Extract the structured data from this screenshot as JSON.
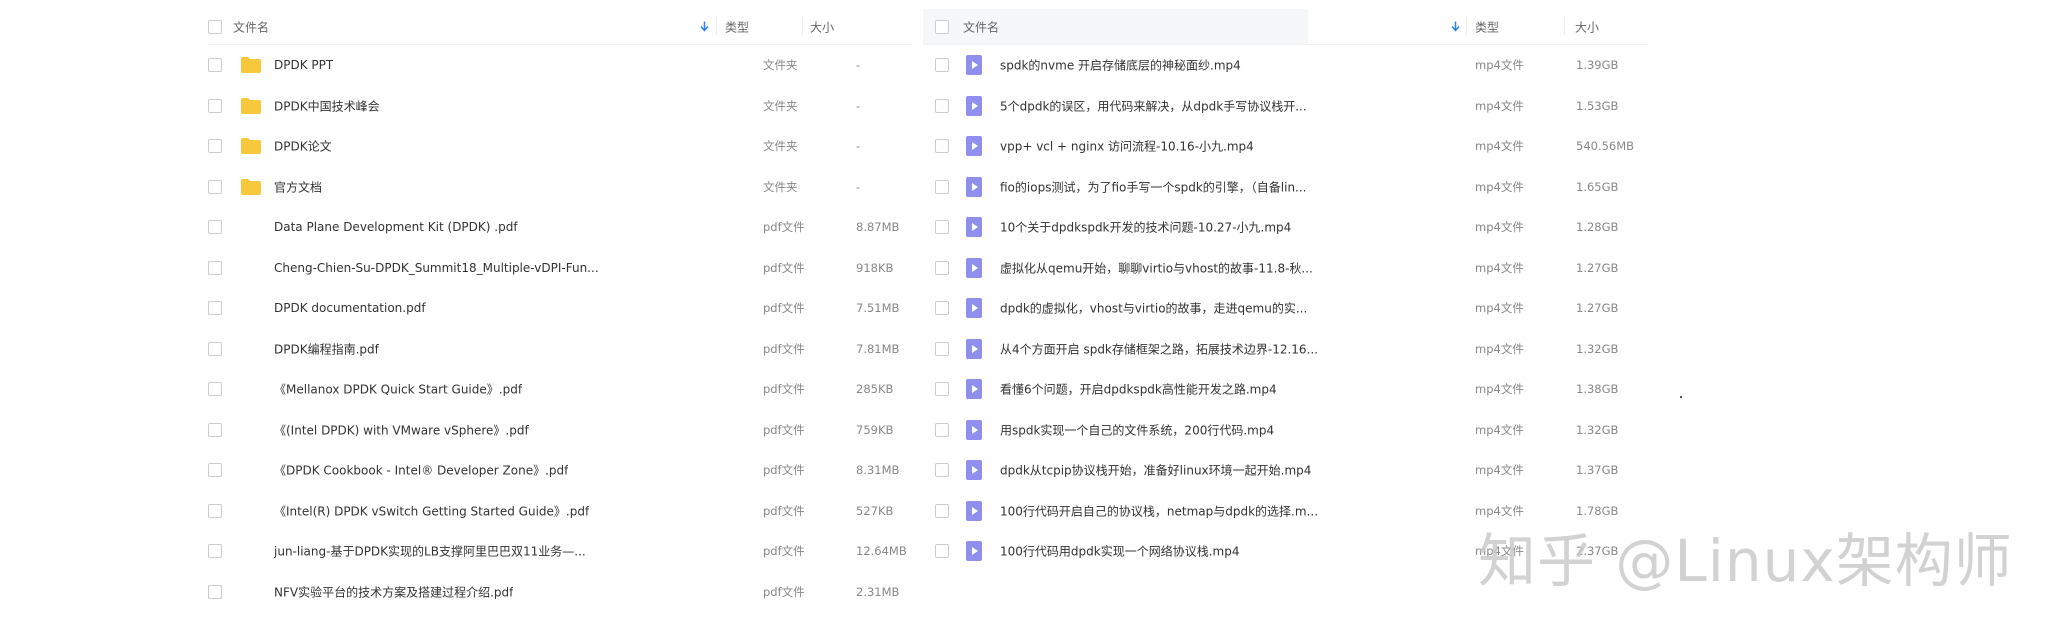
{
  "left": {
    "headers": {
      "name": "文件名",
      "type": "类型",
      "size": "大小"
    },
    "files": [
      {
        "icon": "folder-icon",
        "name": "DPDK  PPT",
        "type": "文件夹",
        "size": "-"
      },
      {
        "icon": "folder-icon",
        "name": "DPDK中国技术峰会",
        "type": "文件夹",
        "size": "-"
      },
      {
        "icon": "folder-icon",
        "name": "DPDK论文",
        "type": "文件夹",
        "size": "-"
      },
      {
        "icon": "folder-icon",
        "name": "官方文档",
        "type": "文件夹",
        "size": "-"
      },
      {
        "icon": "pdf-icon",
        "name": "Data Plane Development Kit (DPDK) .pdf",
        "type": "pdf文件",
        "size": "8.87MB"
      },
      {
        "icon": "pdf-icon",
        "name": "Cheng-Chien-Su-DPDK_Summit18_Multiple-vDPI-Fun...",
        "type": "pdf文件",
        "size": "918KB"
      },
      {
        "icon": "pdf-icon",
        "name": "DPDK documentation.pdf",
        "type": "pdf文件",
        "size": "7.51MB"
      },
      {
        "icon": "pdf-icon",
        "name": "DPDK编程指南.pdf",
        "type": "pdf文件",
        "size": "7.81MB"
      },
      {
        "icon": "pdf-icon",
        "name": "《Mellanox DPDK Quick Start Guide》.pdf",
        "type": "pdf文件",
        "size": "285KB"
      },
      {
        "icon": "pdf-icon",
        "name": "《(Intel DPDK) with VMware vSphere》.pdf",
        "type": "pdf文件",
        "size": "759KB"
      },
      {
        "icon": "pdf-icon",
        "name": "《DPDK Cookbook - Intel® Developer Zone》.pdf",
        "type": "pdf文件",
        "size": "8.31MB"
      },
      {
        "icon": "pdf-icon",
        "name": "《Intel(R) DPDK vSwitch Getting Started Guide》.pdf",
        "type": "pdf文件",
        "size": "527KB"
      },
      {
        "icon": "pdf-icon",
        "name": "jun-liang-基于DPDK实现的LB支撑阿里巴巴双11业务—...",
        "type": "pdf文件",
        "size": "12.64MB"
      },
      {
        "icon": "pdf-icon",
        "name": "NFV实验平台的技术方案及搭建过程介绍.pdf",
        "type": "pdf文件",
        "size": "2.31MB"
      }
    ]
  },
  "right": {
    "headers": {
      "name": "文件名",
      "type": "类型",
      "size": "大小"
    },
    "files": [
      {
        "icon": "video-icon",
        "name": "spdk的nvme 开启存储底层的神秘面纱.mp4",
        "type": "mp4文件",
        "size": "1.39GB"
      },
      {
        "icon": "video-icon",
        "name": "5个dpdk的误区，用代码来解决，从dpdk手写协议栈开...",
        "type": "mp4文件",
        "size": "1.53GB"
      },
      {
        "icon": "video-icon",
        "name": "vpp+ vcl + nginx 访问流程-10.16-小九.mp4",
        "type": "mp4文件",
        "size": "540.56MB"
      },
      {
        "icon": "video-icon",
        "name": "fio的iops测试，为了fio手写一个spdk的引擎，（自备lin...",
        "type": "mp4文件",
        "size": "1.65GB"
      },
      {
        "icon": "video-icon",
        "name": "10个关于dpdkspdk开发的技术问题-10.27-小九.mp4",
        "type": "mp4文件",
        "size": "1.28GB"
      },
      {
        "icon": "video-icon",
        "name": "虚拟化从qemu开始，聊聊virtio与vhost的故事-11.8-秋...",
        "type": "mp4文件",
        "size": "1.27GB"
      },
      {
        "icon": "video-icon",
        "name": "dpdk的虚拟化，vhost与virtio的故事，走进qemu的实...",
        "type": "mp4文件",
        "size": "1.27GB"
      },
      {
        "icon": "video-icon",
        "name": "从4个方面开启 spdk存储框架之路，拓展技术边界-12.16...",
        "type": "mp4文件",
        "size": "1.32GB"
      },
      {
        "icon": "video-icon",
        "name": "看懂6个问题，开启dpdkspdk高性能开发之路.mp4",
        "type": "mp4文件",
        "size": "1.38GB"
      },
      {
        "icon": "video-icon",
        "name": "用spdk实现一个自己的文件系统，200行代码.mp4",
        "type": "mp4文件",
        "size": "1.32GB"
      },
      {
        "icon": "video-icon",
        "name": "dpdk从tcpip协议栈开始，准备好linux环境一起开始.mp4",
        "type": "mp4文件",
        "size": "1.37GB"
      },
      {
        "icon": "video-icon",
        "name": "100行代码开启自己的协议栈，netmap与dpdk的选择.m...",
        "type": "mp4文件",
        "size": "1.78GB"
      },
      {
        "icon": "video-icon",
        "name": "100行代码用dpdk实现一个网络协议栈.mp4",
        "type": "mp4文件",
        "size": "2.37GB"
      }
    ]
  },
  "watermark": "知乎 @Linux架构师",
  "colors": {
    "folder": "#f8c83c",
    "pdf": "#ef6b6b",
    "video": "#8f8ff0",
    "sort_arrow": "#2b83f6"
  }
}
